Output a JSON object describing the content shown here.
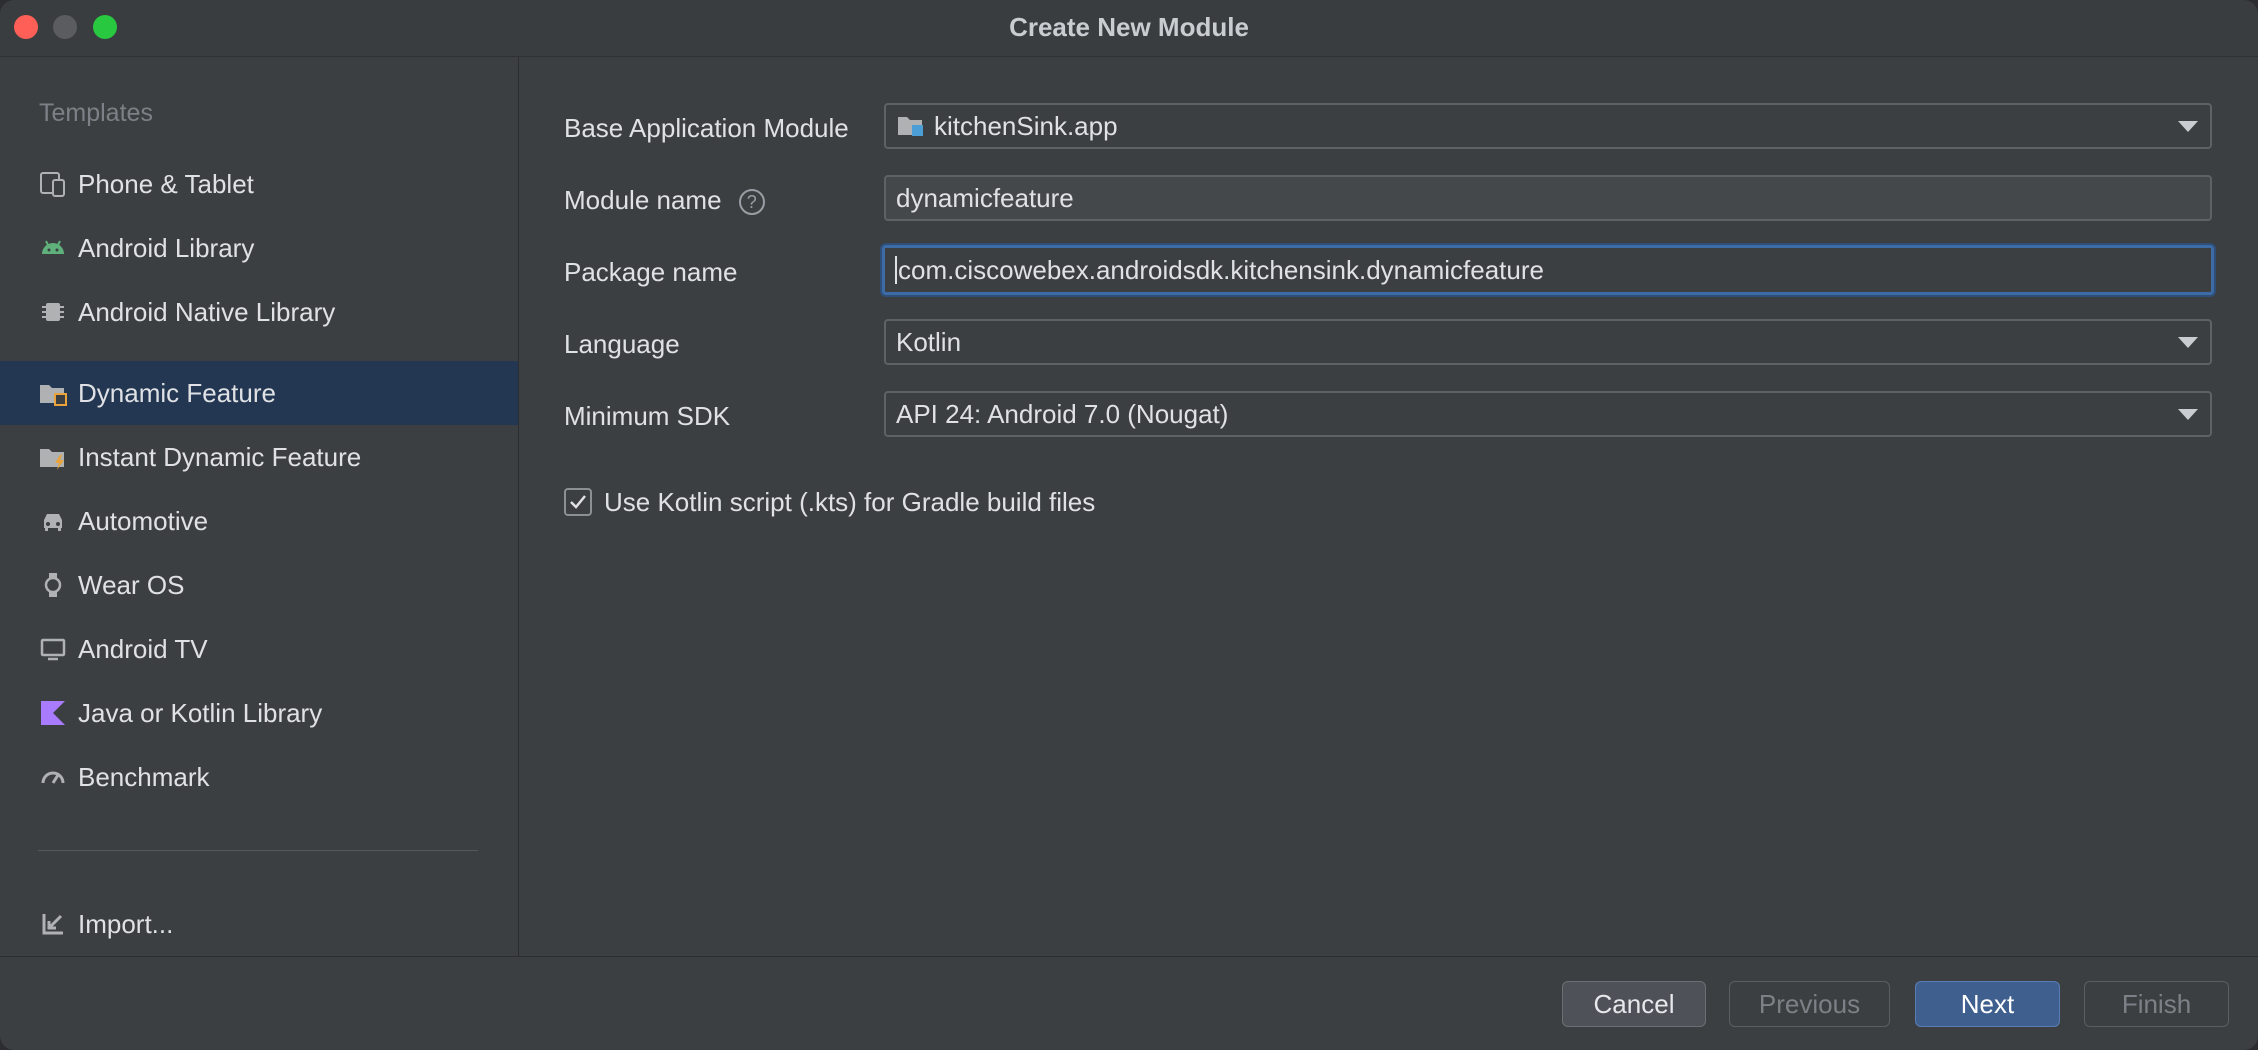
{
  "window": {
    "title": "Create New Module"
  },
  "sidebar": {
    "header": "Templates",
    "items": [
      {
        "label": "Phone & Tablet",
        "icon": "phone-tablet-icon"
      },
      {
        "label": "Android Library",
        "icon": "android-icon"
      },
      {
        "label": "Android Native Library",
        "icon": "chip-icon"
      },
      {
        "label": "Dynamic Feature",
        "icon": "folder-module-icon",
        "selected": true
      },
      {
        "label": "Instant Dynamic Feature",
        "icon": "folder-instant-icon"
      },
      {
        "label": "Automotive",
        "icon": "car-icon"
      },
      {
        "label": "Wear OS",
        "icon": "watch-icon"
      },
      {
        "label": "Android TV",
        "icon": "tv-icon"
      },
      {
        "label": "Java or Kotlin Library",
        "icon": "kotlin-icon"
      },
      {
        "label": "Benchmark",
        "icon": "gauge-icon"
      }
    ],
    "import_label": "Import..."
  },
  "form": {
    "base_module": {
      "label": "Base Application Module",
      "value": "kitchenSink.app"
    },
    "module_name": {
      "label": "Module name",
      "value": "dynamicfeature"
    },
    "package_name": {
      "label": "Package name",
      "value": "com.ciscowebex.androidsdk.kitchensink.dynamicfeature"
    },
    "language": {
      "label": "Language",
      "value": "Kotlin"
    },
    "min_sdk": {
      "label": "Minimum SDK",
      "value": "API 24: Android 7.0 (Nougat)"
    },
    "kts_checkbox": {
      "label": "Use Kotlin script (.kts) for Gradle build files",
      "checked": true
    }
  },
  "footer": {
    "cancel": "Cancel",
    "previous": "Previous",
    "next": "Next",
    "finish": "Finish"
  },
  "colors": {
    "selected_bg": "#233752",
    "focus_border": "#3d6ba5",
    "primary_button": "#3f5f8f",
    "close": "#ff5f57",
    "maximize": "#28c840"
  }
}
